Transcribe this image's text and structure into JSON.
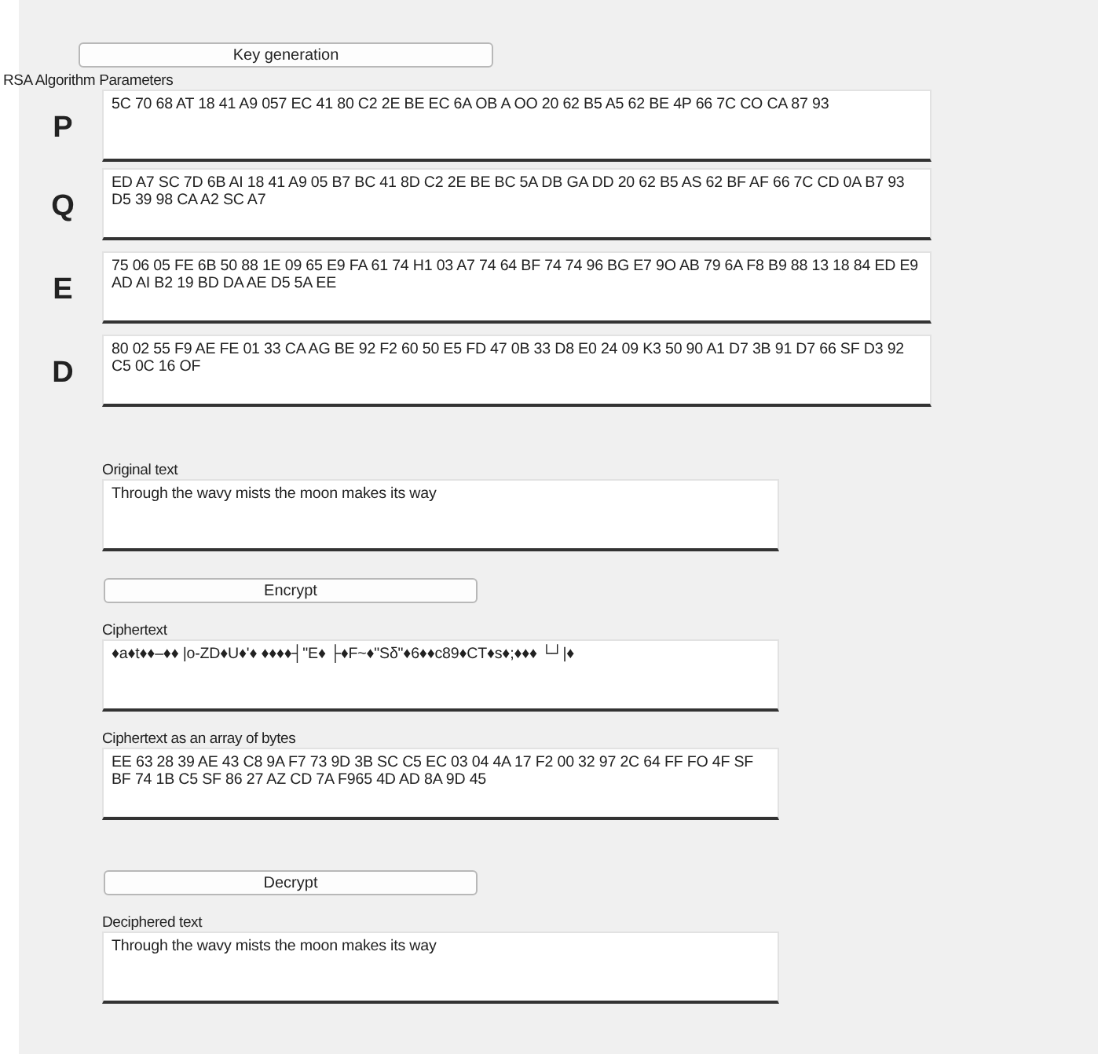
{
  "key_button": "Key generation",
  "params_title": "RSA Algorithm Parameters",
  "params": [
    {
      "letter": "P",
      "value": "5C 70 68 AT 18 41 A9 057 EC 41 80 C2 2E BE EC 6A OB A OO 20 62 B5 A5 62 BE 4P 66 7C CO CA 87 93"
    },
    {
      "letter": "Q",
      "value": "ED A7 SC 7D 6B AI 18 41 A9 05 B7 BC 41 8D C2 2E BE BC 5A DB GA DD 20 62 B5 AS 62 BF AF 66 7C CD 0A B7 93 D5 39 98 CA A2 SC A7"
    },
    {
      "letter": "E",
      "value": "75 06 05 FE 6B 50 88 1E 09 65 E9 FA 61 74 H1 03 A7 74 64 BF 74 74 96 BG E7 9O AB 79 6A F8 B9 88 13 18 84 ED E9 AD AI B2 19 BD DA AE D5 5A EE"
    },
    {
      "letter": "D",
      "value": "80 02 55 F9 AE FE 01 33 CA AG BE 92 F2 60 50 E5 FD 47 0B 33 D8 E0 24 09 K3 50 90 A1 D7 3B 91 D7 66 SF D3 92 C5 0C 16 OF"
    }
  ],
  "sections": [
    {
      "kind": "field",
      "label": "Original text",
      "value": "Through the wavy mists the moon makes its way"
    },
    {
      "kind": "button",
      "label": "Encrypt"
    },
    {
      "kind": "field",
      "label": "Ciphertext",
      "value": "♦a♦t♦♦–♦♦ |o-ZD♦U♦'♦ ♦♦♦♦┤\"E♦ ├♦F~♦\"Sδ\"♦6♦♦c89♦CT♦s♦;♦♦♦ └┘|♦"
    },
    {
      "kind": "field",
      "label": "Ciphertext as an array of bytes",
      "value": "EE 63 28 39 AE 43 C8 9A F7 73 9D 3B SC C5 EC 03 04 4A 17 F2 00 32 97 2C 64 FF FO 4F SF BF 74 1B C5 SF 86 27 AZ CD 7A F965 4D AD 8A 9D 45"
    },
    {
      "kind": "button",
      "label": "Decrypt"
    },
    {
      "kind": "field",
      "label": "Deciphered text",
      "value": "Through the wavy mists the moon makes its way"
    }
  ]
}
